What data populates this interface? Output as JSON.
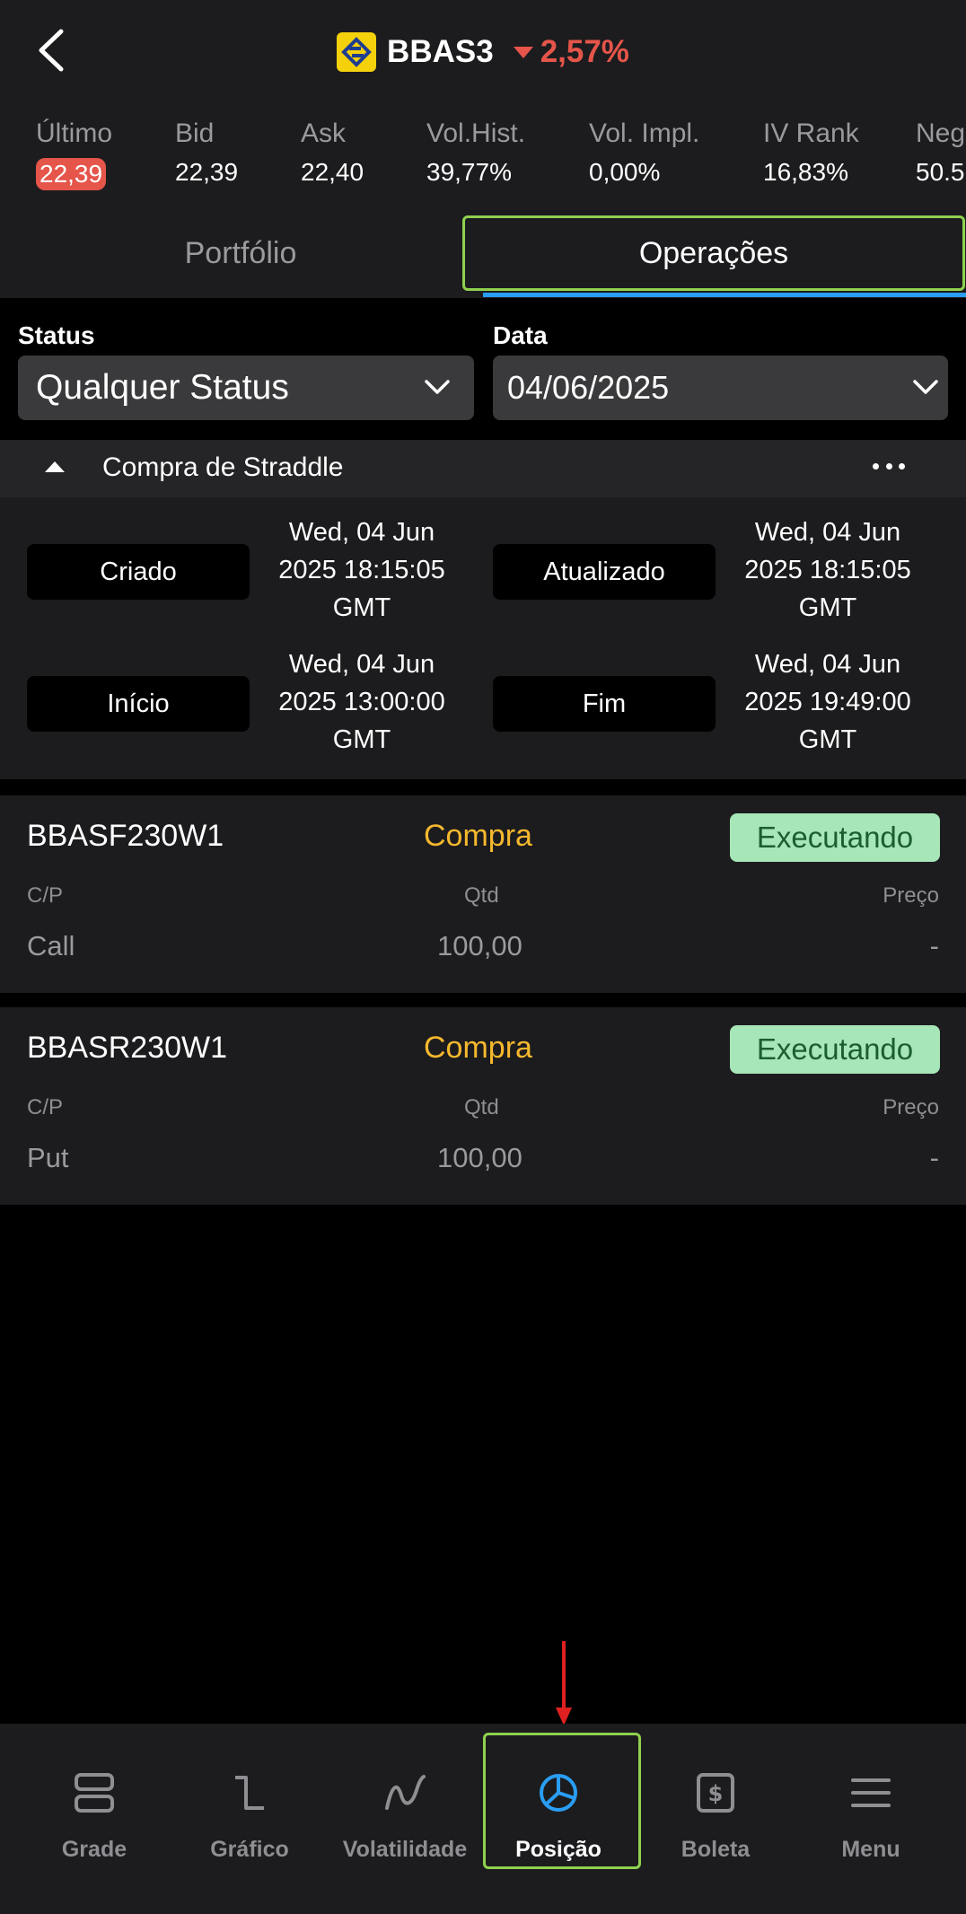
{
  "header": {
    "ticker": "BBAS3",
    "change": "2,57%"
  },
  "quotes": [
    {
      "label": "Último",
      "value": "22,39"
    },
    {
      "label": "Bid",
      "value": "22,39"
    },
    {
      "label": "Ask",
      "value": "22,40"
    },
    {
      "label": "Vol.Hist.",
      "value": "39,77%"
    },
    {
      "label": "Vol. Impl.",
      "value": "0,00%"
    },
    {
      "label": "IV Rank",
      "value": "16,83%"
    },
    {
      "label": "Neg",
      "value": "50.5"
    }
  ],
  "tabs": {
    "portfolio": "Portfólio",
    "operations": "Operações"
  },
  "filters": {
    "status_label": "Status",
    "status_value": "Qualquer Status",
    "date_label": "Data",
    "date_value": "04/06/2025"
  },
  "strategy": {
    "title": "Compra de Straddle",
    "created_label": "Criado",
    "created_value": [
      "Wed, 04 Jun",
      "2025 18:15:05",
      "GMT"
    ],
    "updated_label": "Atualizado",
    "updated_value": [
      "Wed, 04 Jun",
      "2025 18:15:05",
      "GMT"
    ],
    "start_label": "Início",
    "start_value": [
      "Wed, 04 Jun",
      "2025 13:00:00",
      "GMT"
    ],
    "end_label": "Fim",
    "end_value": [
      "Wed, 04 Jun",
      "2025 19:49:00",
      "GMT"
    ]
  },
  "legs": [
    {
      "symbol": "BBASF230W1",
      "side": "Compra",
      "status": "Executando",
      "cp_header": "C/P",
      "qty_header": "Qtd",
      "price_header": "Preço",
      "cp": "Call",
      "qty": "100,00",
      "price": "-"
    },
    {
      "symbol": "BBASR230W1",
      "side": "Compra",
      "status": "Executando",
      "cp_header": "C/P",
      "qty_header": "Qtd",
      "price_header": "Preço",
      "cp": "Put",
      "qty": "100,00",
      "price": "-"
    }
  ],
  "nav": [
    {
      "label": "Grade",
      "icon": "grid-icon"
    },
    {
      "label": "Gráfico",
      "icon": "chart-step-icon"
    },
    {
      "label": "Volatilidade",
      "icon": "volatility-curve-icon"
    },
    {
      "label": "Posição",
      "icon": "pie-chart-icon",
      "active": true
    },
    {
      "label": "Boleta",
      "icon": "dollar-ticket-icon"
    },
    {
      "label": "Menu",
      "icon": "hamburger-icon"
    }
  ],
  "colors": {
    "accent_blue": "#2a9df4",
    "negative_red": "#e5554a",
    "buy_yellow": "#f5b82e",
    "status_green_bg": "#a6e6b8",
    "highlight_frame": "#8fd14f"
  }
}
